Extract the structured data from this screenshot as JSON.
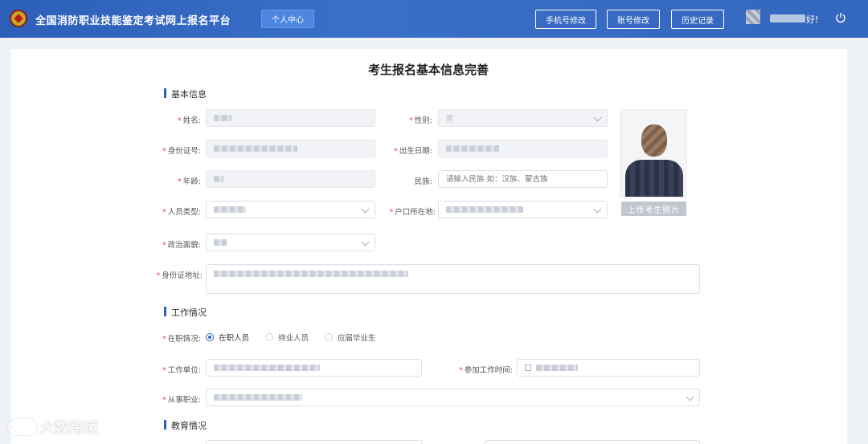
{
  "header": {
    "title": "全国消防职业技能鉴定考试网上报名平台",
    "nav_personal": "个人中心",
    "phone_btn": "手机号修改",
    "account_btn": "账号修改",
    "history_btn": "历史记录",
    "greeting": "好!"
  },
  "page_title": "考生报名基本信息完善",
  "basic": {
    "section": "基本信息",
    "name_label": "姓名:",
    "gender_label": "性别:",
    "gender_value": "男",
    "idno_label": "身份证号:",
    "birth_label": "出生日期:",
    "age_label": "年龄:",
    "ethnic_label": "民族:",
    "ethnic_placeholder": "请输入民族 如：汉族、蒙古族",
    "ptype_label": "人员类型:",
    "hukou_label": "户口所在地:",
    "political_label": "政治面貌:",
    "address_label": "身份证地址:",
    "upload_btn": "上传考生照片"
  },
  "work": {
    "section": "工作情况",
    "status_label": "在职情况:",
    "options": [
      "在职人员",
      "待业人员",
      "应届毕业生"
    ],
    "selected": 0,
    "employer_label": "工作单位:",
    "start_label": "参加工作时间:",
    "occupation_label": "从事职业:"
  },
  "edu": {
    "section": "教育情况"
  },
  "watermark": "大数跨境"
}
